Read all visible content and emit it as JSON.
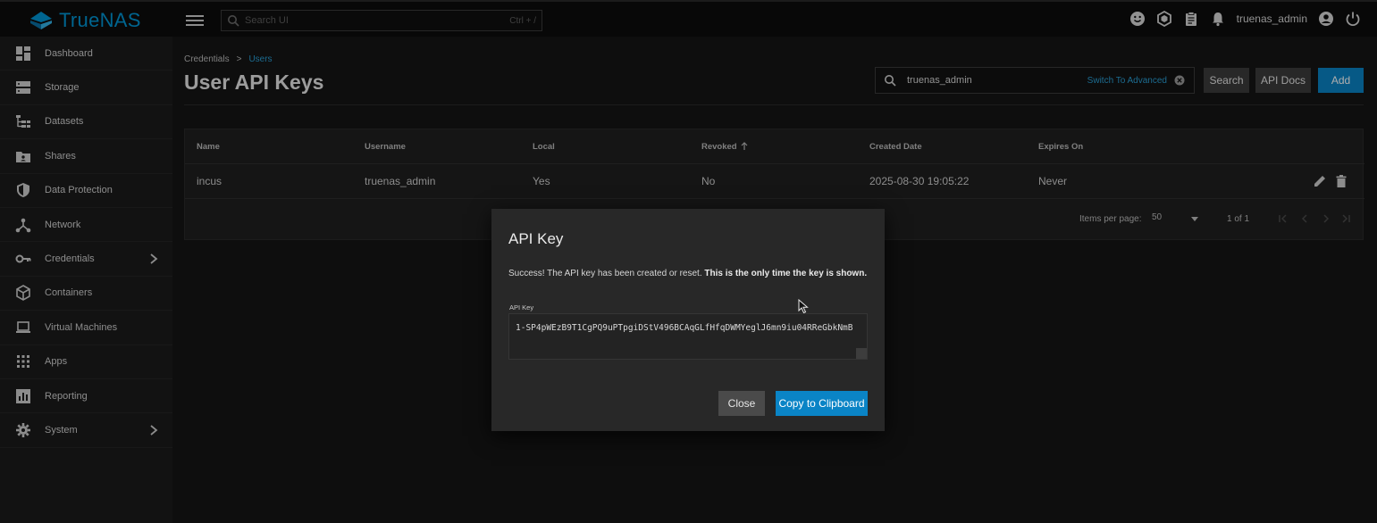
{
  "app": {
    "name": "TrueNAS",
    "brand_color": "#0095d5"
  },
  "topbar": {
    "search_placeholder": "Search UI",
    "search_shortcut": "Ctrl + /",
    "username": "truenas_admin",
    "icons": [
      "feedback-icon",
      "truecommand-icon",
      "jobs-icon",
      "alerts-icon",
      "account-icon",
      "power-icon"
    ]
  },
  "sidebar": {
    "items": [
      {
        "label": "Dashboard",
        "icon": "dashboard-icon"
      },
      {
        "label": "Storage",
        "icon": "storage-icon"
      },
      {
        "label": "Datasets",
        "icon": "datasets-icon"
      },
      {
        "label": "Shares",
        "icon": "shares-icon"
      },
      {
        "label": "Data Protection",
        "icon": "shield-icon"
      },
      {
        "label": "Network",
        "icon": "network-icon"
      },
      {
        "label": "Credentials",
        "icon": "key-icon",
        "has_children": true
      },
      {
        "label": "Containers",
        "icon": "cube-icon"
      },
      {
        "label": "Virtual Machines",
        "icon": "laptop-icon"
      },
      {
        "label": "Apps",
        "icon": "apps-grid-icon"
      },
      {
        "label": "Reporting",
        "icon": "reporting-icon"
      },
      {
        "label": "System",
        "icon": "gear-icon",
        "has_children": true
      }
    ]
  },
  "page": {
    "breadcrumb": [
      "Credentials",
      "Users"
    ],
    "breadcrumb_sep": ">",
    "title": "User API Keys"
  },
  "filter": {
    "value": "truenas_admin",
    "advanced_link": "Switch To Advanced"
  },
  "actions": {
    "search": "Search",
    "api_docs": "API Docs",
    "add": "Add"
  },
  "table": {
    "columns": [
      "Name",
      "Username",
      "Local",
      "Revoked",
      "Created Date",
      "Expires On"
    ],
    "rows": [
      [
        "incus",
        "truenas_admin",
        "Yes",
        "No",
        "2025-08-30 19:05:22",
        "Never"
      ]
    ],
    "items_per_page_label": "Items per page:",
    "items_per_page": "50",
    "range": "1 of 1"
  },
  "dialog": {
    "title": "API Key",
    "message": "Success! The API key has been created or reset.",
    "message_bold": "This is the only time the key is shown.",
    "key_label": "API Key",
    "key_value": "1-SP4pWEzB9T1CgPQ9uPTpgiDStV496BCAqGLfHfqDWMYeglJ6mn9iu04RReGbkNmB",
    "close": "Close",
    "copy": "Copy to Clipboard"
  },
  "colors": {
    "accent": "#0a84c6",
    "link": "#2a9fd6",
    "background": "#151515",
    "sidebar": "#1b1b1b"
  }
}
